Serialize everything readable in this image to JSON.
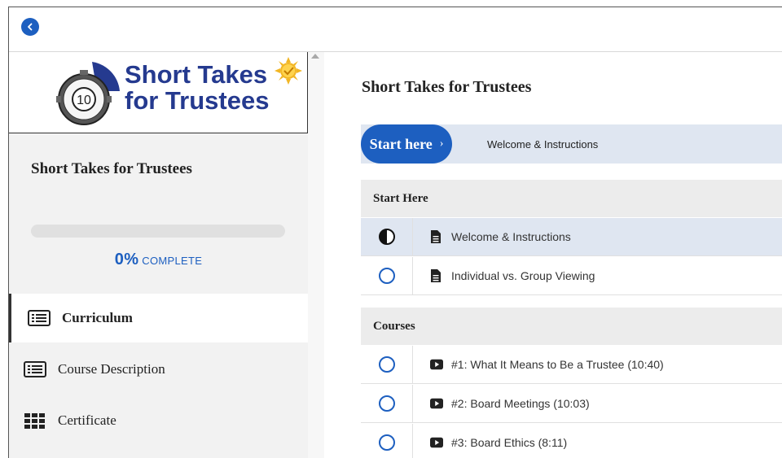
{
  "header": {
    "back_icon": "chevron-left-icon"
  },
  "logo": {
    "line1": "Short Takes",
    "line2": "for Trustees",
    "stopwatch_number": "10"
  },
  "sidebar": {
    "course_title": "Short Takes for Trustees",
    "progress": {
      "percent_value": 0,
      "percent_label": "0%",
      "complete_label": "COMPLETE"
    },
    "nav": [
      {
        "label": "Curriculum",
        "icon": "list-icon",
        "active": true
      },
      {
        "label": "Course Description",
        "icon": "list-icon",
        "active": false
      },
      {
        "label": "Certificate",
        "icon": "grid-icon",
        "active": false
      }
    ]
  },
  "main": {
    "title": "Short Takes for Trustees",
    "start": {
      "button_label": "Start here",
      "chevron": "›",
      "next_lesson": "Welcome & Instructions"
    },
    "sections": [
      {
        "title": "Start Here",
        "lessons": [
          {
            "title": "Welcome & Instructions",
            "type": "document-icon",
            "status": "in-progress"
          },
          {
            "title": "Individual vs. Group Viewing",
            "type": "document-icon",
            "status": "not-started"
          }
        ]
      },
      {
        "title": "Courses",
        "lessons": [
          {
            "title": "#1: What It Means to Be a Trustee (10:40)",
            "type": "video-icon",
            "status": "not-started"
          },
          {
            "title": "#2: Board Meetings (10:03)",
            "type": "video-icon",
            "status": "not-started"
          },
          {
            "title": "#3: Board Ethics (8:11)",
            "type": "video-icon",
            "status": "not-started"
          }
        ]
      }
    ]
  },
  "colors": {
    "accent": "#1d5fc0",
    "logo_text": "#253a8f",
    "highlight_row": "#dfe6f1"
  }
}
